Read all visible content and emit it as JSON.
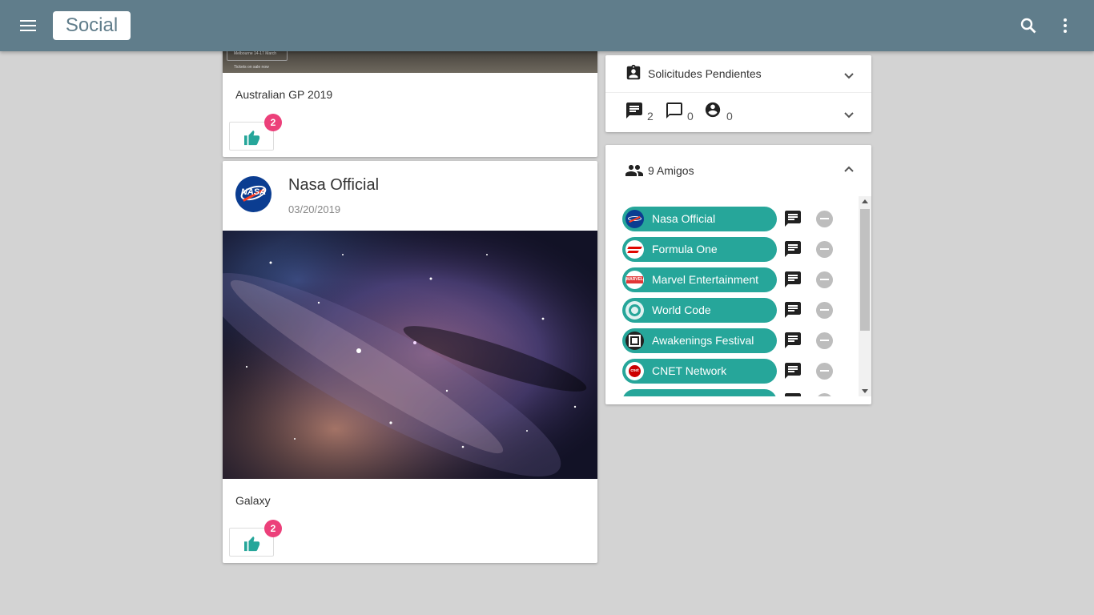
{
  "app": {
    "brand": "Social",
    "colors": {
      "topbar": "#607d8b",
      "chip": "#26a69a",
      "badge": "#ec407a",
      "like": "#26a69a"
    }
  },
  "posts": [
    {
      "image_text": [
        "Melbourne 14-17 March",
        "Tickets on sale now"
      ],
      "caption": "Australian GP 2019",
      "likes": "2"
    },
    {
      "author": "Nasa Official",
      "avatar_text": "NASA",
      "date": "03/20/2019",
      "caption": "Galaxy",
      "likes": "2"
    }
  ],
  "pending": {
    "title": "Solicitudes Pendientes",
    "counts": {
      "messages": "2",
      "chats": "0",
      "requests": "0"
    }
  },
  "friends": {
    "title": "9 Amigos",
    "items": [
      {
        "name": "Nasa Official",
        "icon": "nasa-logo"
      },
      {
        "name": "Formula One",
        "icon": "f1-logo"
      },
      {
        "name": "Marvel Entertainment",
        "icon": "marvel-logo",
        "logo_text": "MARVEL"
      },
      {
        "name": "World Code",
        "icon": "world-code-logo"
      },
      {
        "name": "Awakenings Festival",
        "icon": "awakenings-logo"
      },
      {
        "name": "CNET Network",
        "icon": "cnet-logo",
        "logo_text": "cnet"
      }
    ]
  }
}
